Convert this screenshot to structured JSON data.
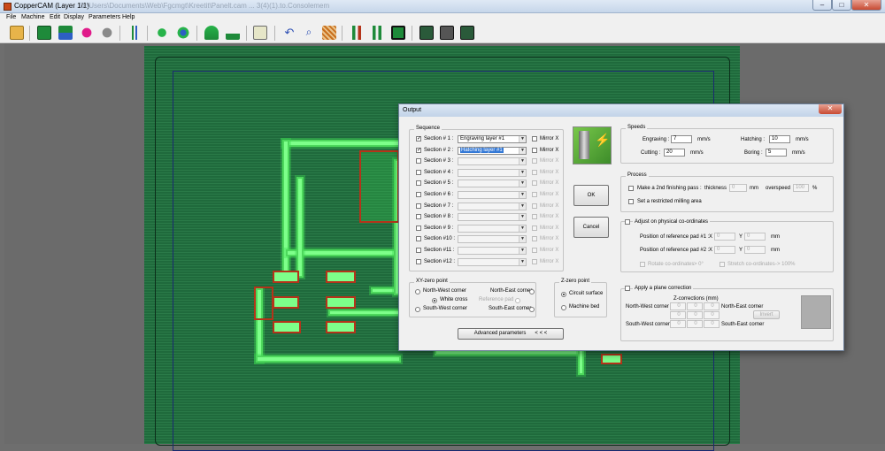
{
  "window": {
    "title": "CopperCAM   (Layer 1/1)",
    "ghost_path": "D:\\Users\\Documents\\Web\\Fgcmgt\\Kreetit\\Panelt.cam ... 3(4)(1).to.Consolemem",
    "controls": [
      "–",
      "□",
      "✕"
    ]
  },
  "menu": [
    "File",
    "Machine",
    "Edit",
    "Display",
    "Parameters",
    "Help"
  ],
  "toolbar_icons": [
    "open-icon",
    "gerber-icon",
    "swap-layers-icon",
    "pad-red-icon",
    "pad-grey-icon",
    "drill-icon",
    "pad-shape-icon",
    "pad-circle-icon",
    "move-icon",
    "route-icon",
    "tool-icon",
    "undo-icon",
    "zoom-icon",
    "texture-icon",
    "contour-icon",
    "hatching-icon",
    "board-icon",
    "layer-1-icon",
    "layer-2-icon",
    "layer-3-icon"
  ],
  "dialog": {
    "title": "Output",
    "close": "✕",
    "sequence": {
      "label": "Sequence",
      "sections": [
        {
          "label": "Section # 1 :",
          "checked": true,
          "value": "Engraving layer #1",
          "mirror": "Mirror X",
          "enabled": true,
          "selected": false
        },
        {
          "label": "Section # 2 :",
          "checked": true,
          "value": "Hatching layer #1",
          "mirror": "Mirror X",
          "enabled": true,
          "selected": true
        },
        {
          "label": "Section # 3 :",
          "checked": false,
          "value": "",
          "mirror": "Mirror X",
          "enabled": false
        },
        {
          "label": "Section # 4 :",
          "checked": false,
          "value": "",
          "mirror": "Mirror X",
          "enabled": false
        },
        {
          "label": "Section # 5 :",
          "checked": false,
          "value": "",
          "mirror": "Mirror X",
          "enabled": false
        },
        {
          "label": "Section # 6 :",
          "checked": false,
          "value": "",
          "mirror": "Mirror X",
          "enabled": false
        },
        {
          "label": "Section # 7 :",
          "checked": false,
          "value": "",
          "mirror": "Mirror X",
          "enabled": false
        },
        {
          "label": "Section # 8 :",
          "checked": false,
          "value": "",
          "mirror": "Mirror X",
          "enabled": false
        },
        {
          "label": "Section # 9 :",
          "checked": false,
          "value": "",
          "mirror": "Mirror X",
          "enabled": false
        },
        {
          "label": "Section #10 :",
          "checked": false,
          "value": "",
          "mirror": "Mirror X",
          "enabled": false
        },
        {
          "label": "Section #11 :",
          "checked": false,
          "value": "",
          "mirror": "Mirror X",
          "enabled": false
        },
        {
          "label": "Section #12 :",
          "checked": false,
          "value": "",
          "mirror": "Mirror X",
          "enabled": false
        }
      ]
    },
    "xy_zero": {
      "label": "XY-zero point",
      "north_west": "North-West corner",
      "north_east": "North-East corner",
      "white_cross": "White cross",
      "reference_pad": "Reference pad",
      "south_west": "South-West corner",
      "south_east": "South-East corner"
    },
    "z_zero": {
      "label": "Z-zero point",
      "circuit_surface": "Circuit surface",
      "machine_bed": "Machine bed"
    },
    "advanced_button": "Advanced parameters",
    "advanced_arrows": "< < <",
    "ok_button": "OK",
    "cancel_button": "Cancel",
    "speeds": {
      "label": "Speeds",
      "engraving_label": "Engraving :",
      "engraving_value": "7",
      "engraving_unit": "mm/s",
      "hatching_label": "Hatching :",
      "hatching_value": "10",
      "hatching_unit": "mm/s",
      "cutting_label": "Cutting :",
      "cutting_value": "20",
      "cutting_unit": "mm/s",
      "boring_label": "Boring :",
      "boring_value": "5",
      "boring_unit": "mm/s"
    },
    "process": {
      "label": "Process",
      "second_pass": "Make a 2nd finishing pass :",
      "thickness_label": "thickness",
      "thickness_value": "0",
      "thickness_unit": "mm",
      "overspeed_label": "overspeed",
      "overspeed_value": "100",
      "overspeed_unit": "%",
      "restricted_area": "Set a restricted milling area"
    },
    "physical": {
      "label": "Adjust on physical co-ordinates",
      "pad1_label": "Position of reference pad #1 :",
      "pad2_label": "Position of reference pad #2 :",
      "x_label": "X",
      "y_label": "Y",
      "pad1_x": "0",
      "pad1_y": "0",
      "pad2_x": "0",
      "pad2_y": "0",
      "unit": "mm",
      "rotate": "Rotate co-ordinates",
      "rotate_suffix": "-> 0°",
      "stretch": "Stretch co-ordinates",
      "stretch_suffix": "-> 100%"
    },
    "plane": {
      "label": "Apply a plane correction",
      "z_corrections": "Z-corrections (mm)",
      "north_west": "North-West corner",
      "north_east": "North-East corner",
      "south_west": "South-West corner",
      "south_east": "South-East corner",
      "grid": [
        "0",
        "0",
        "0",
        "0",
        "0",
        "0",
        "0",
        "0",
        "0"
      ],
      "invert_button": "Invert"
    }
  }
}
